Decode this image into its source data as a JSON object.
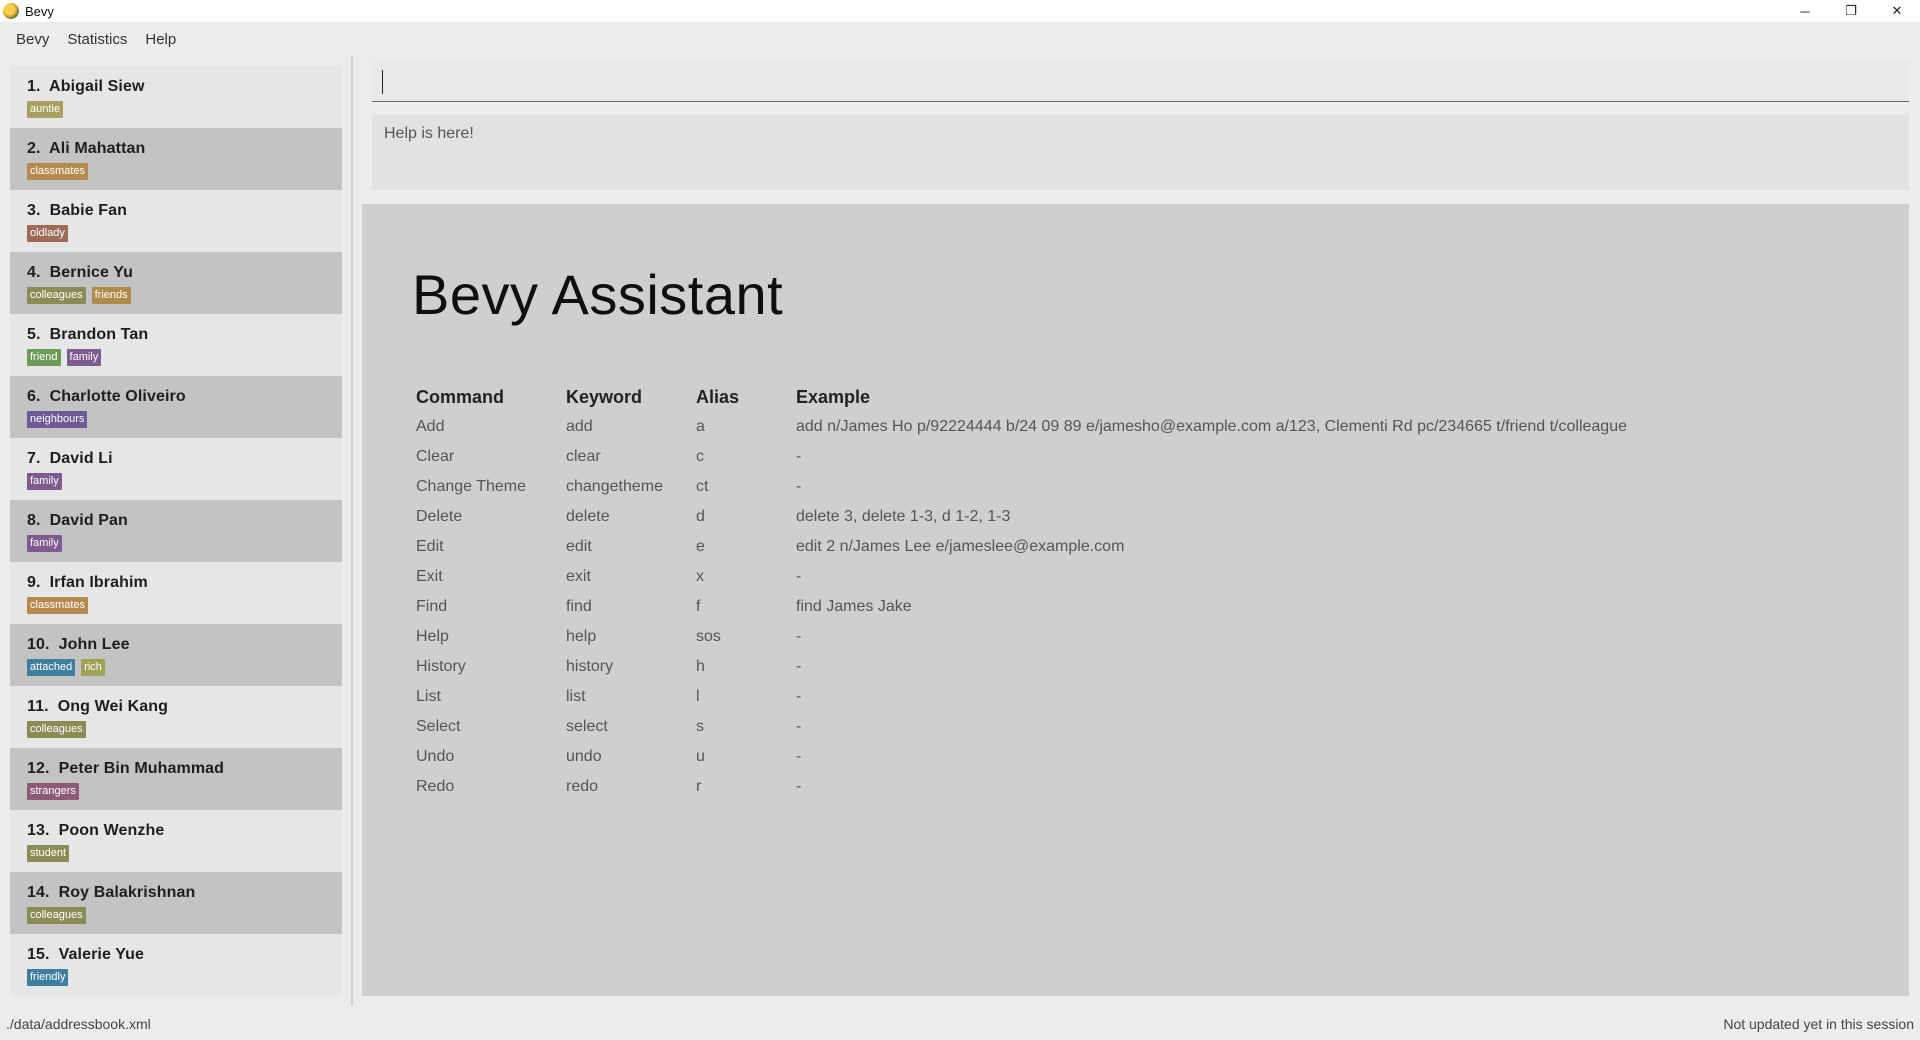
{
  "window": {
    "title": "Bevy",
    "controls": {
      "minimize": "─",
      "restore": "❐",
      "close": "✕"
    }
  },
  "menu": [
    "Bevy",
    "Statistics",
    "Help"
  ],
  "persons": [
    {
      "index": "1.",
      "name": "Abigail Siew",
      "tags": [
        {
          "label": "auntie",
          "color": "#a8a061"
        }
      ]
    },
    {
      "index": "2.",
      "name": "Ali Mahattan",
      "tags": [
        {
          "label": "classmates",
          "color": "#b58a4f"
        }
      ]
    },
    {
      "index": "3.",
      "name": "Babie Fan",
      "tags": [
        {
          "label": "oldlady",
          "color": "#9d6a58"
        }
      ]
    },
    {
      "index": "4.",
      "name": "Bernice Yu",
      "tags": [
        {
          "label": "colleagues",
          "color": "#8a8c55"
        },
        {
          "label": "friends",
          "color": "#b08a4a"
        }
      ]
    },
    {
      "index": "5.",
      "name": "Brandon Tan",
      "tags": [
        {
          "label": "friend",
          "color": "#6c9a5a"
        },
        {
          "label": "family",
          "color": "#7e5b8f"
        }
      ]
    },
    {
      "index": "6.",
      "name": "Charlotte Oliveiro",
      "tags": [
        {
          "label": "neighbours",
          "color": "#6d5a96"
        }
      ]
    },
    {
      "index": "7.",
      "name": "David Li",
      "tags": [
        {
          "label": "family",
          "color": "#7e5b8f"
        }
      ]
    },
    {
      "index": "8.",
      "name": "David Pan",
      "tags": [
        {
          "label": "family",
          "color": "#7e5b8f"
        }
      ]
    },
    {
      "index": "9.",
      "name": "Irfan Ibrahim",
      "tags": [
        {
          "label": "classmates",
          "color": "#b58a4f"
        }
      ]
    },
    {
      "index": "10.",
      "name": "John Lee",
      "tags": [
        {
          "label": "attached",
          "color": "#3f7f9e"
        },
        {
          "label": "rich",
          "color": "#a3a058"
        }
      ]
    },
    {
      "index": "11.",
      "name": "Ong Wei Kang",
      "tags": [
        {
          "label": "colleagues",
          "color": "#8a8c55"
        }
      ]
    },
    {
      "index": "12.",
      "name": "Peter Bin Muhammad",
      "tags": [
        {
          "label": "strangers",
          "color": "#8d5a78"
        }
      ]
    },
    {
      "index": "13.",
      "name": "Poon Wenzhe",
      "tags": [
        {
          "label": "student",
          "color": "#8a8c55"
        }
      ]
    },
    {
      "index": "14.",
      "name": "Roy Balakrishnan",
      "tags": [
        {
          "label": "colleagues",
          "color": "#8a8c55"
        }
      ]
    },
    {
      "index": "15.",
      "name": "Valerie Yue",
      "tags": [
        {
          "label": "friendly",
          "color": "#3f7f9e"
        }
      ]
    }
  ],
  "command_box": {
    "value": ""
  },
  "result_display": "Help is here!",
  "assistant": {
    "title": "Bevy Assistant",
    "headers": [
      "Command",
      "Keyword",
      "Alias",
      "Example"
    ],
    "rows": [
      [
        "Add",
        "add",
        "a",
        "add n/James Ho p/92224444 b/24 09 89 e/jamesho@example.com a/123, Clementi Rd pc/234665 t/friend t/colleague"
      ],
      [
        "Clear",
        "clear",
        "c",
        "-"
      ],
      [
        "Change Theme",
        "changetheme",
        "ct",
        "-"
      ],
      [
        "Delete",
        "delete",
        "d",
        "delete 3, delete 1-3, d 1-2, 1-3"
      ],
      [
        "Edit",
        "edit",
        "e",
        "edit 2 n/James Lee e/jameslee@example.com"
      ],
      [
        "Exit",
        "exit",
        "x",
        "-"
      ],
      [
        "Find",
        "find",
        "f",
        "find James Jake"
      ],
      [
        "Help",
        "help",
        "sos",
        "-"
      ],
      [
        "History",
        "history",
        "h",
        "-"
      ],
      [
        "List",
        "list",
        "l",
        "-"
      ],
      [
        "Select",
        "select",
        "s",
        "-"
      ],
      [
        "Undo",
        "undo",
        "u",
        "-"
      ],
      [
        "Redo",
        "redo",
        "r",
        "-"
      ]
    ]
  },
  "status": {
    "file_path": "./data/addressbook.xml",
    "sync_status": "Not updated yet in this session"
  }
}
